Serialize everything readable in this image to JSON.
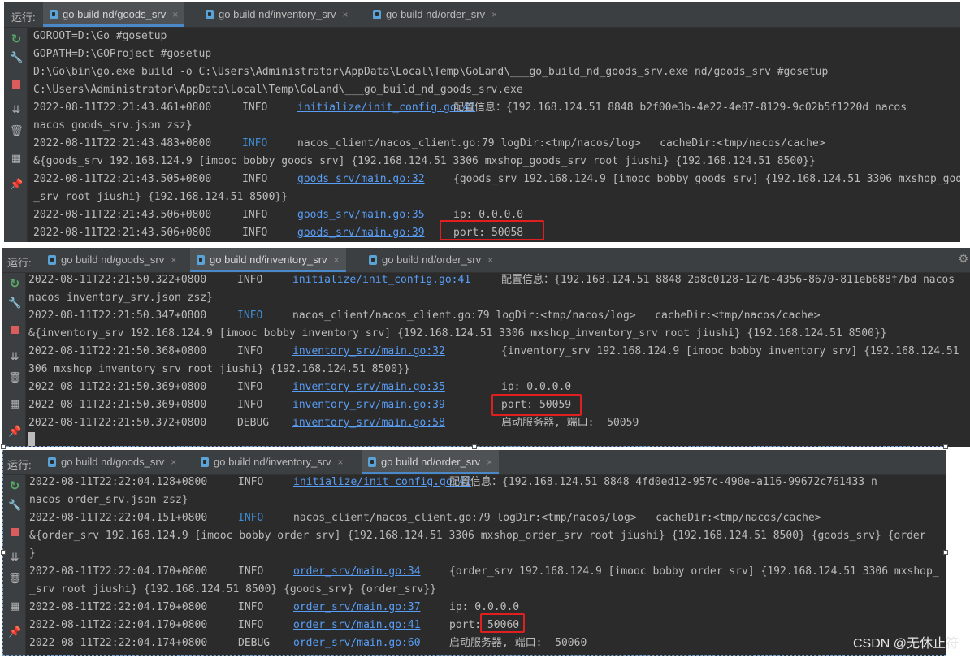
{
  "run_label": "运行:",
  "tabs": [
    "go build nd/goods_srv",
    "go build nd/inventory_srv",
    "go build nd/order_srv"
  ],
  "close_glyph": "×",
  "colors": {
    "panel_bg": "#2b2b2b",
    "toolbar_bg": "#3c3f41",
    "info_blue": "#3f8dd4",
    "link_blue": "#589df6",
    "highlight_red": "#e02020"
  },
  "panels": [
    {
      "active_tab": 0,
      "lines": [
        {
          "plain": "GOROOT=D:\\Go #gosetup"
        },
        {
          "plain": "GOPATH=D:\\GOProject #gosetup"
        },
        {
          "plain": "D:\\Go\\bin\\go.exe build -o C:\\Users\\Administrator\\AppData\\Local\\Temp\\GoLand\\___go_build_nd_goods_srv.exe nd/goods_srv #gosetup"
        },
        {
          "plain": "C:\\Users\\Administrator\\AppData\\Local\\Temp\\GoLand\\___go_build_nd_goods_srv.exe"
        },
        {
          "ts": "2022-08-11T22:21:43.461+0800",
          "lvl": "INFO",
          "src": "initialize/init_config.go:41",
          "msg": "配置信息：{192.168.124.51 8848 b2f00e3b-4e22-4e87-8129-9c02b5f1220d nacos"
        },
        {
          "plain": "nacos goods_srv.json zsz}"
        },
        {
          "ts": "2022-08-11T22:21:43.483+0800",
          "lvl": "INFO",
          "blue": true,
          "msg": "nacos_client/nacos_client.go:79 logDir:<tmp/nacos/log>   cacheDir:<tmp/nacos/cache>"
        },
        {
          "plain": "&{goods_srv 192.168.124.9 [imooc bobby goods srv] {192.168.124.51 3306 mxshop_goods_srv root jiushi} {192.168.124.51 8500}}"
        },
        {
          "ts": "2022-08-11T22:21:43.505+0800",
          "lvl": "INFO",
          "src": "goods_srv/main.go:32",
          "msg": "{goods_srv 192.168.124.9 [imooc bobby goods srv] {192.168.124.51 3306 mxshop_goods"
        },
        {
          "plain": "_srv root jiushi} {192.168.124.51 8500}}"
        },
        {
          "ts": "2022-08-11T22:21:43.506+0800",
          "lvl": "INFO",
          "src": "goods_srv/main.go:35",
          "msg": "ip: 0.0.0.0"
        },
        {
          "ts": "2022-08-11T22:21:43.506+0800",
          "lvl": "INFO",
          "src": "goods_srv/main.go:39",
          "msg": "port: 50058"
        },
        {
          "plain": "□"
        }
      ]
    },
    {
      "active_tab": 1,
      "lines": [
        {
          "ts": "2022-08-11T22:21:50.322+0800",
          "lvl": "INFO",
          "src": "initialize/init_config.go:41",
          "msg": "配置信息：{192.168.124.51 8848 2a8c0128-127b-4356-8670-811eb688f7bd nacos"
        },
        {
          "plain": "nacos inventory_srv.json zsz}"
        },
        {
          "ts": "2022-08-11T22:21:50.347+0800",
          "lvl": "INFO",
          "blue": true,
          "msg": "nacos_client/nacos_client.go:79 logDir:<tmp/nacos/log>   cacheDir:<tmp/nacos/cache>"
        },
        {
          "plain": "&{inventory_srv 192.168.124.9 [imooc bobby inventory srv] {192.168.124.51 3306 mxshop_inventory_srv root jiushi} {192.168.124.51 8500}}"
        },
        {
          "ts": "2022-08-11T22:21:50.368+0800",
          "lvl": "INFO",
          "src": "inventory_srv/main.go:32",
          "msg": "{inventory_srv 192.168.124.9 [imooc bobby inventory srv] {192.168.124.51"
        },
        {
          "plain": "306 mxshop_inventory_srv root jiushi} {192.168.124.51 8500}}"
        },
        {
          "ts": "2022-08-11T22:21:50.369+0800",
          "lvl": "INFO",
          "src": "inventory_srv/main.go:35",
          "msg": "ip: 0.0.0.0"
        },
        {
          "ts": "2022-08-11T22:21:50.369+0800",
          "lvl": "INFO",
          "src": "inventory_srv/main.go:39",
          "msg": "port: 50059"
        },
        {
          "ts": "2022-08-11T22:21:50.372+0800",
          "lvl": "DEBUG",
          "src": "inventory_srv/main.go:58",
          "msg": "启动服务器, 端口:  50059"
        }
      ]
    },
    {
      "active_tab": 2,
      "lines": [
        {
          "ts": "2022-08-11T22:22:04.128+0800",
          "lvl": "INFO",
          "src": "initialize/init_config.go:41",
          "msg": "配置信息：{192.168.124.51 8848 4fd0ed12-957c-490e-a116-99672c761433 n"
        },
        {
          "plain": "nacos order_srv.json zsz}"
        },
        {
          "ts": "2022-08-11T22:22:04.151+0800",
          "lvl": "INFO",
          "blue": true,
          "msg": "nacos_client/nacos_client.go:79 logDir:<tmp/nacos/log>   cacheDir:<tmp/nacos/cache>"
        },
        {
          "plain": "&{order_srv 192.168.124.9 [imooc bobby order srv] {192.168.124.51 3306 mxshop_order_srv root jiushi} {192.168.124.51 8500} {goods_srv} {order"
        },
        {
          "plain": "}"
        },
        {
          "ts": "2022-08-11T22:22:04.170+0800",
          "lvl": "INFO",
          "src": "order_srv/main.go:34",
          "msg": "{order_srv 192.168.124.9 [imooc bobby order srv] {192.168.124.51 3306 mxshop_"
        },
        {
          "plain": "_srv root jiushi} {192.168.124.51 8500} {goods_srv} {order_srv}}"
        },
        {
          "ts": "2022-08-11T22:22:04.170+0800",
          "lvl": "INFO",
          "src": "order_srv/main.go:37",
          "msg": "ip: 0.0.0.0"
        },
        {
          "ts": "2022-08-11T22:22:04.170+0800",
          "lvl": "INFO",
          "src": "order_srv/main.go:41",
          "msg": "port: 50060"
        },
        {
          "ts": "2022-08-11T22:22:04.174+0800",
          "lvl": "DEBUG",
          "src": "order_srv/main.go:60",
          "msg": "启动服务器, 端口:  50060"
        }
      ]
    }
  ],
  "watermark": "CSDN @无休止符"
}
